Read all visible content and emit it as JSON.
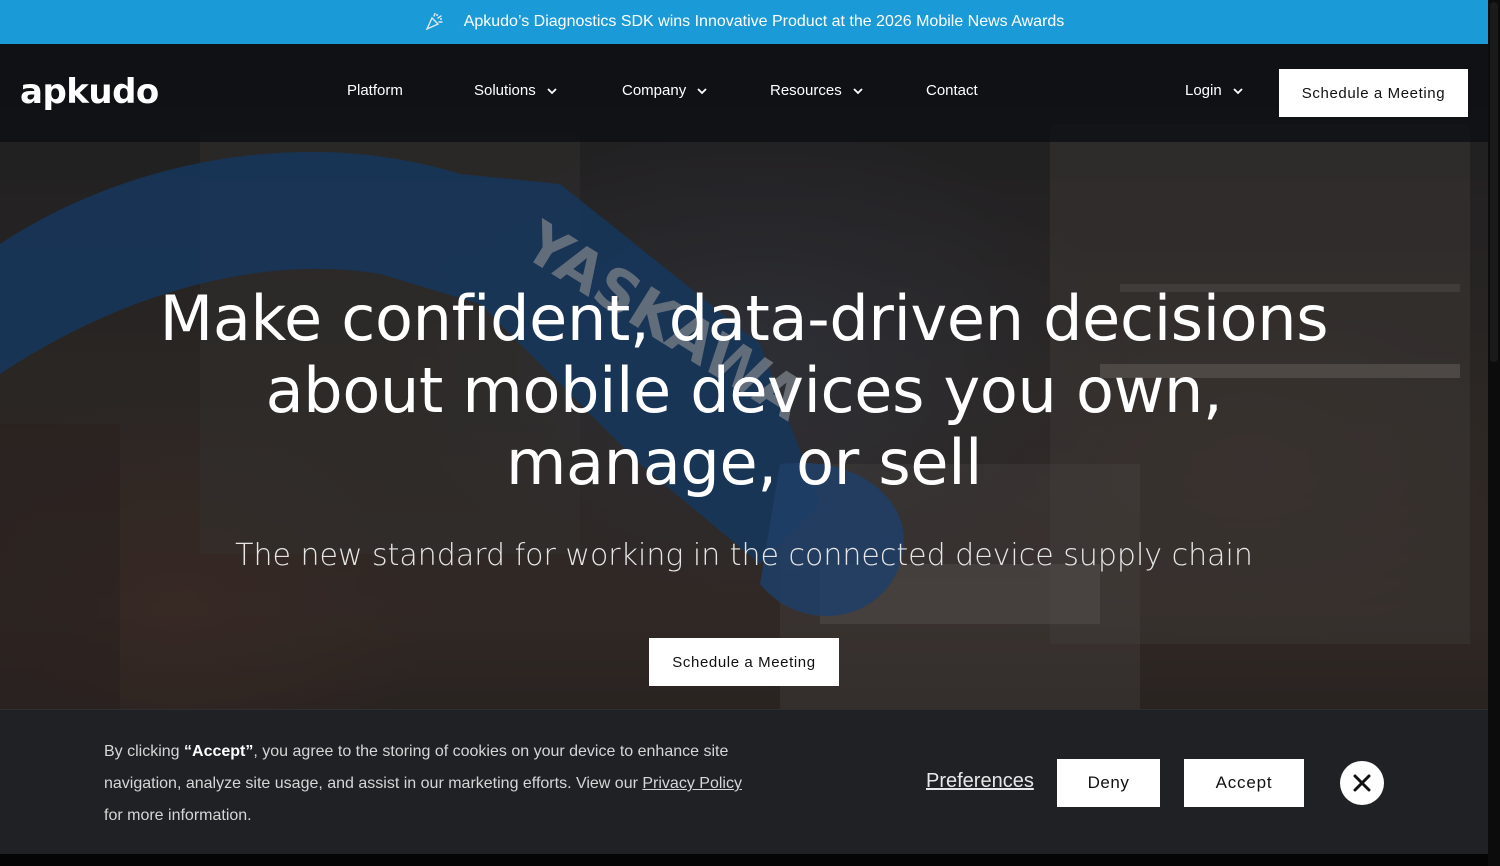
{
  "announcement": {
    "icon": "party-popper-icon",
    "text": "Apkudo’s Diagnostics SDK wins Innovative Product at the 2026 Mobile News Awards",
    "background": "#1a9ad6"
  },
  "nav": {
    "logo": "apkudo",
    "items": [
      {
        "label": "Platform",
        "has_dropdown": false
      },
      {
        "label": "Solutions",
        "has_dropdown": true
      },
      {
        "label": "Company",
        "has_dropdown": true
      },
      {
        "label": "Resources",
        "has_dropdown": true
      },
      {
        "label": "Contact",
        "has_dropdown": false
      }
    ],
    "login_label": "Login",
    "cta_label": "Schedule a Meeting"
  },
  "hero": {
    "headline": "Make confident, data-driven decisions about mobile devices you own, manage, or sell",
    "subhead": "The new standard for working in the connected device supply chain",
    "cta_label": "Schedule a Meeting",
    "background_text": "YASKAWA"
  },
  "cookie": {
    "text_prefix": "By clicking ",
    "text_bold": "“Accept”",
    "text_middle": ", you agree to the storing of cookies on your device to enhance site navigation, analyze site usage, and assist in our marketing efforts. View our ",
    "privacy_link": "Privacy Policy",
    "text_suffix": " for more information.",
    "preferences_label": "Preferences",
    "deny_label": "Deny",
    "accept_label": "Accept",
    "close_icon": "close-icon"
  },
  "colors": {
    "accent_blue": "#1a9ad6",
    "banner_bg": "#1f2124",
    "button_bg": "#ffffff"
  }
}
